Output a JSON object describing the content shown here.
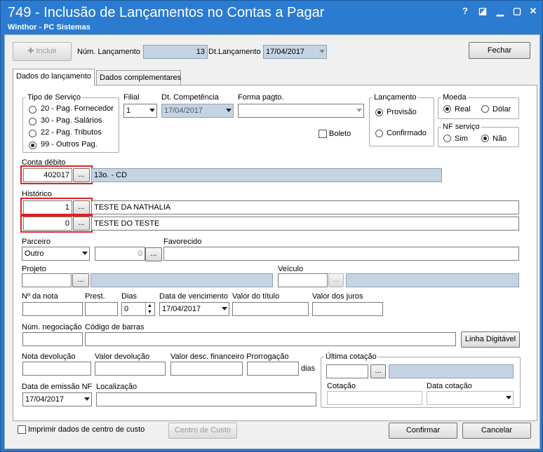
{
  "window": {
    "title": "749 - Inclusão de Lançamentos no Contas a Pagar",
    "subtitle": "Winthor - PC Sistemas",
    "controls": {
      "help": "?",
      "restore": "◪",
      "close": "✕"
    }
  },
  "toolbar": {
    "incluir_label": "Incluir",
    "num_lancamento_label": "Núm. Lançamento",
    "num_lancamento_value": "13",
    "dt_lancamento_label": "Dt.Lançamento",
    "dt_lancamento_value": "17/04/2017",
    "fechar_label": "Fechar"
  },
  "tabs": [
    {
      "label": "Dados do lançamento",
      "active": true
    },
    {
      "label": "Dados complementares",
      "active": false
    }
  ],
  "tipo_servico": {
    "title": "Tipo de Serviço",
    "options": [
      {
        "label": "20 - Pag. Fornecedor",
        "selected": false
      },
      {
        "label": "30 - Pag. Salários",
        "selected": false
      },
      {
        "label": "22 - Pag. Tributos",
        "selected": false
      },
      {
        "label": "99 - Outros Pag.",
        "selected": true
      }
    ]
  },
  "filial": {
    "label": "Filial",
    "value": "1"
  },
  "competencia": {
    "label": "Dt. Competência",
    "value": "17/04/2017"
  },
  "forma_pagto": {
    "label": "Forma pagto.",
    "value": ""
  },
  "boleto": {
    "label": "Boleto",
    "checked": false
  },
  "lancamento": {
    "title": "Lançamento",
    "options": [
      {
        "label": "Provisão",
        "selected": true
      },
      {
        "label": "Confirmado",
        "selected": false
      }
    ]
  },
  "moeda": {
    "title": "Moeda",
    "options": [
      {
        "label": "Real",
        "selected": true
      },
      {
        "label": "Dólar",
        "selected": false
      }
    ]
  },
  "nf_servico": {
    "title": "NF serviço",
    "options": [
      {
        "label": "Sim",
        "selected": false
      },
      {
        "label": "Não",
        "selected": true
      }
    ]
  },
  "conta_debito": {
    "label": "Conta débito",
    "code": "402017",
    "description": "13o. - CD"
  },
  "historico": {
    "label": "Histórico",
    "rows": [
      {
        "code": "1",
        "text": "TESTE DA NATHALIA"
      },
      {
        "code": "0",
        "text": "TESTE DO TESTE"
      }
    ]
  },
  "ellipsis": "...",
  "parceiro": {
    "label": "Parceiro",
    "value": "Outro",
    "code": "0"
  },
  "favorecido": {
    "label": "Favorecido",
    "value": ""
  },
  "projeto": {
    "label": "Projeto"
  },
  "veiculo": {
    "label": "Veículo"
  },
  "nota": {
    "label": "Nº da nota",
    "value": ""
  },
  "prest": {
    "label": "Prest.",
    "value": ""
  },
  "dias": {
    "label": "Dias",
    "value": "0"
  },
  "vencimento": {
    "label": "Data de vencimento",
    "value": "17/04/2017"
  },
  "valor_titulo": {
    "label": "Valor do título",
    "value": ""
  },
  "valor_juros": {
    "label": "Valor dos juros",
    "value": ""
  },
  "num_negociacao": {
    "label": "Núm. negociação"
  },
  "codigo_barras": {
    "label": "Código de barras"
  },
  "linha_digitavel": {
    "label": "Linha Digitável"
  },
  "nota_devolucao": {
    "label": "Nota devolução"
  },
  "valor_devolucao": {
    "label": "Valor devolução"
  },
  "valor_desc_fin": {
    "label": "Valor desc. financeiro"
  },
  "prorrogacao": {
    "label": "Prorrogação",
    "unit": "dias"
  },
  "ultima_cotacao": {
    "title": "Última cotação",
    "cotacao_label": "Cotação",
    "data_cotacao_label": "Data cotação"
  },
  "emissao_nf": {
    "label": "Data de emissão NF",
    "value": "17/04/2017"
  },
  "localizacao": {
    "label": "Localização",
    "value": ""
  },
  "footer": {
    "imprimir_label": "Imprimir dados de centro de custo",
    "centro_custo_label": "Centro de Custo",
    "confirmar_label": "Confirmar",
    "cancelar_label": "Cancelar"
  }
}
